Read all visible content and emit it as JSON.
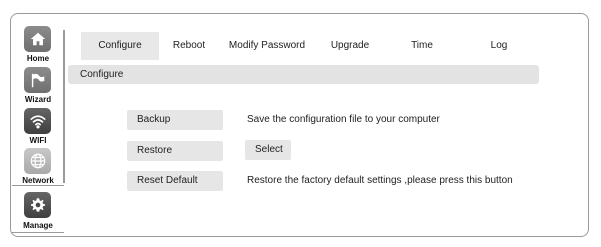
{
  "sidebar": {
    "items": [
      {
        "label": "Home",
        "icon": "home-icon"
      },
      {
        "label": "Wizard",
        "icon": "wizard-icon"
      },
      {
        "label": "WIFI",
        "icon": "wifi-icon"
      },
      {
        "label": "Network",
        "icon": "globe-icon"
      },
      {
        "label": "Manage",
        "icon": "gear-icon"
      }
    ],
    "active": "Manage"
  },
  "tabs": [
    {
      "label": "Configure"
    },
    {
      "label": "Reboot"
    },
    {
      "label": "Modify Password"
    },
    {
      "label": "Upgrade"
    },
    {
      "label": "Time"
    },
    {
      "label": "Log"
    }
  ],
  "active_tab": "Configure",
  "section": {
    "title": "Configure"
  },
  "rows": [
    {
      "button": "Backup",
      "description": "Save the configuration file to your computer"
    },
    {
      "button": "Restore",
      "select_label": "Select"
    },
    {
      "button": "Reset Default",
      "description": "Restore the factory default settings ,please press this button"
    }
  ],
  "colors": {
    "frame_border": "#9a9a9a",
    "tab_active_bg": "#e8e8e8",
    "button_bg": "#e6e6e6"
  }
}
